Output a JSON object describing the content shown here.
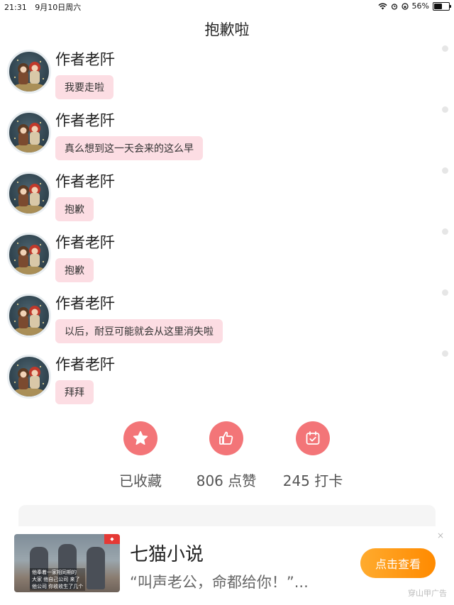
{
  "status": {
    "time": "21:31",
    "date": "9月10日周六",
    "battery": "56%",
    "battery_level": 0.56
  },
  "page": {
    "title": "抱歉啦"
  },
  "messages": [
    {
      "author": "作者老阡",
      "text": "我要走啦"
    },
    {
      "author": "作者老阡",
      "text": "真么想到这一天会来的这么早"
    },
    {
      "author": "作者老阡",
      "text": "抱歉"
    },
    {
      "author": "作者老阡",
      "text": "抱歉"
    },
    {
      "author": "作者老阡",
      "text": "以后，耐豆可能就会从这里消失啦"
    },
    {
      "author": "作者老阡",
      "text": "拜拜"
    }
  ],
  "actions": {
    "favorite": {
      "label": "已收藏",
      "icon": "star-icon"
    },
    "like": {
      "label": "806 点赞",
      "icon": "thumbs-up-icon"
    },
    "checkin": {
      "label": "245 打卡",
      "icon": "calendar-check-icon"
    }
  },
  "ad": {
    "app_name": "七猫小说",
    "description": "“叫声老公，命都给你！”...",
    "button_label": "点击查看",
    "close": "×",
    "source": "穿山甲广告",
    "thumb_caption": [
      "他奉着一家相同期的",
      "大家 他自己公司 来了",
      "他公司 你收收生了几个"
    ]
  },
  "colors": {
    "accent": "#f37578",
    "bubble": "#fcdde3",
    "ad_button": "#ff9a1a"
  }
}
